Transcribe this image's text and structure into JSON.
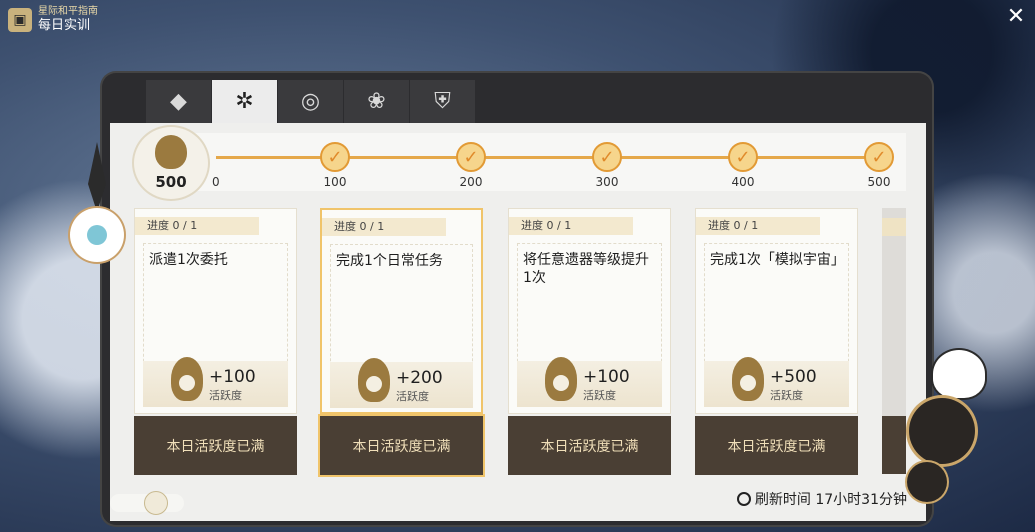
{
  "header": {
    "subtitle": "星际和平指南",
    "title": "每日实训",
    "book_icon": "guide-book-icon",
    "close_icon": "close-icon"
  },
  "tabs": [
    {
      "icon": "daily-training-icon",
      "active": false
    },
    {
      "icon": "target-icon",
      "active": true
    },
    {
      "icon": "compass-icon",
      "active": false
    },
    {
      "icon": "lotus-icon",
      "active": false
    },
    {
      "icon": "shield-icon",
      "active": false
    }
  ],
  "activity": {
    "current": "500",
    "milestones": [
      {
        "label": "0",
        "done": false
      },
      {
        "label": "100",
        "done": true
      },
      {
        "label": "200",
        "done": true
      },
      {
        "label": "300",
        "done": true
      },
      {
        "label": "400",
        "done": true
      },
      {
        "label": "500",
        "done": true
      }
    ]
  },
  "tasks": [
    {
      "progress": "进度 0 / 1",
      "name": "派遣1次委托",
      "reward": "+100",
      "unit": "活跃度",
      "button": "本日活跃度已满"
    },
    {
      "progress": "进度 0 / 1",
      "name": "完成1个日常任务",
      "reward": "+200",
      "unit": "活跃度",
      "button": "本日活跃度已满"
    },
    {
      "progress": "进度 0 / 1",
      "name": "将任意遗器等级提升1次",
      "reward": "+100",
      "unit": "活跃度",
      "button": "本日活跃度已满"
    },
    {
      "progress": "进度 0 / 1",
      "name": "完成1次「模拟宇宙」",
      "reward": "+500",
      "unit": "活跃度",
      "button": "本日活跃度已满"
    }
  ],
  "refresh": {
    "text": "刷新时间 17小时31分钟"
  },
  "colors": {
    "accent": "#e5a84a",
    "button_bg": "#4a3f34",
    "button_text": "#f0dfb9",
    "highlight": "#f0c46a"
  }
}
